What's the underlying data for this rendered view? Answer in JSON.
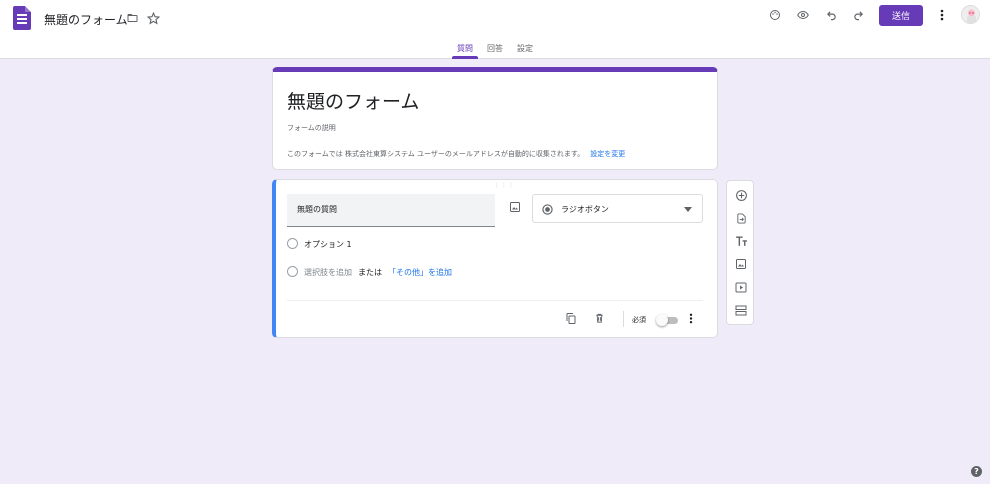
{
  "header": {
    "title": "無題のフォーム",
    "send_label": "送信"
  },
  "tabs": [
    {
      "label": "質問"
    },
    {
      "label": "回答"
    },
    {
      "label": "設定"
    }
  ],
  "form_header": {
    "title": "無題のフォーム",
    "description_placeholder": "フォームの説明",
    "collect_note": "このフォームでは 株式会社東算システム ユーザーのメールアドレスが自動的に収集されます。",
    "collect_link": "設定を変更"
  },
  "question": {
    "title_placeholder": "無題の質問",
    "type_label": "ラジオボタン",
    "option_1": "オプション 1",
    "add_option": "選択肢を追加",
    "or": "または",
    "add_other": "「その他」を追加",
    "required_label": "必須",
    "required": false
  },
  "colors": {
    "brand": "#673ab7",
    "accent_blue": "#4285f4",
    "background": "#f0ebf8"
  },
  "icons": [
    "forms-app-icon",
    "folder-icon",
    "star-icon",
    "palette-icon",
    "preview-eye-icon",
    "undo-icon",
    "redo-icon",
    "more-vert-icon",
    "image-icon",
    "radio-type-icon",
    "dropdown-arrow-icon",
    "copy-icon",
    "delete-icon",
    "add-question-icon",
    "import-questions-icon",
    "title-icon",
    "add-image-icon",
    "add-video-icon",
    "add-section-icon",
    "help-icon"
  ]
}
